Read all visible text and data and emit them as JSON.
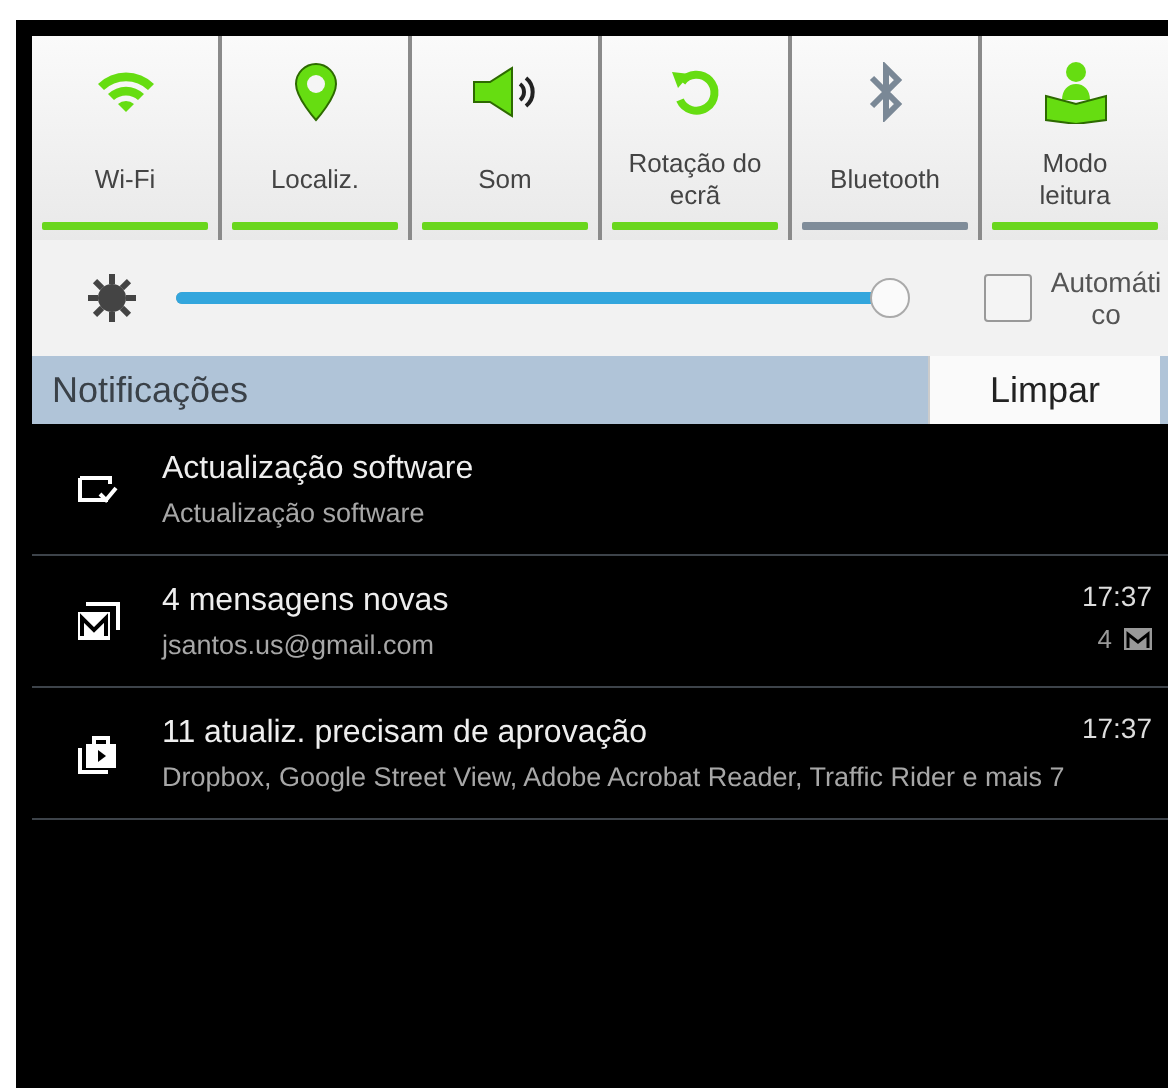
{
  "quick_toggles": [
    {
      "kind": "wifi",
      "label": "Wi-Fi",
      "on": true
    },
    {
      "kind": "location",
      "label": "Localiz.",
      "on": true
    },
    {
      "kind": "sound",
      "label": "Som",
      "on": true
    },
    {
      "kind": "rotation",
      "label": "Rotação do ecrã",
      "on": true
    },
    {
      "kind": "bluetooth",
      "label": "Bluetooth",
      "on": false
    },
    {
      "kind": "reading",
      "label": "Modo leitura",
      "on": true
    }
  ],
  "brightness": {
    "level": 0.98,
    "auto_label": "Automático",
    "auto_checked": false
  },
  "notifications_header": {
    "title": "Notificações",
    "clear_button": "Limpar"
  },
  "notifications": [
    {
      "kind": "update",
      "title": "Actualização software",
      "subtitle": "Actualização software"
    },
    {
      "kind": "mail",
      "title": "4 mensagens novas",
      "subtitle": "jsantos.us@gmail.com",
      "time": "17:37",
      "count": "4"
    },
    {
      "kind": "store",
      "title": "11 atualiz. precisam de aprovação",
      "subtitle": "Dropbox, Google Street View, Adobe Acrobat Reader, Traffic Rider e mais 7",
      "time": "17:37"
    }
  ]
}
